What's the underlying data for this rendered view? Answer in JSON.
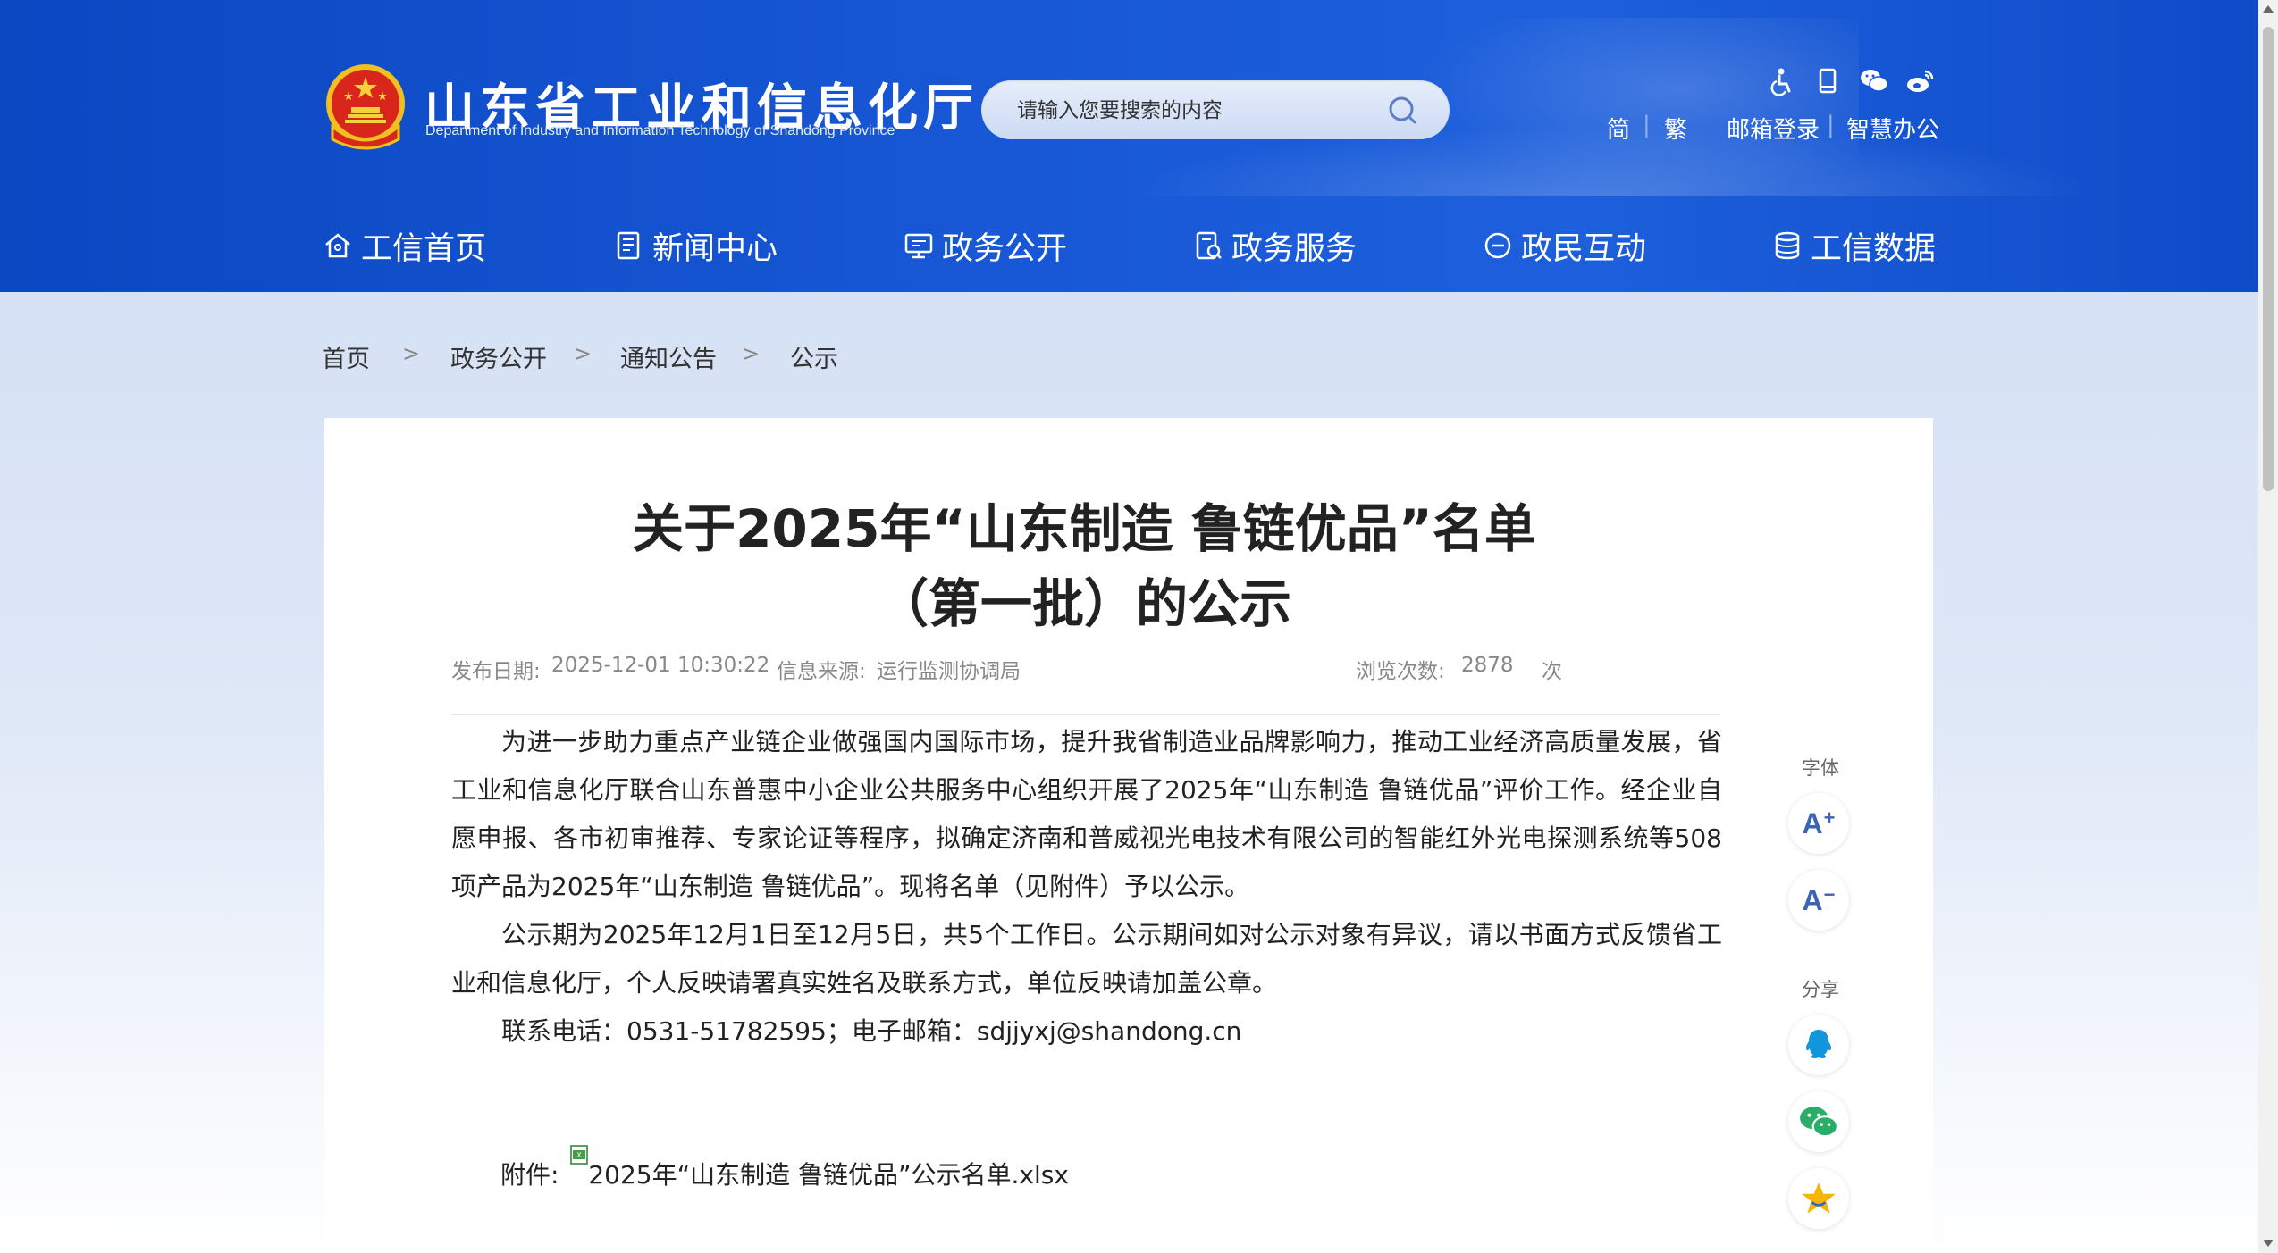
{
  "site": {
    "title": "山东省工业和信息化厅",
    "subtitle": "Department of Industry and Information Technology of Shandong Province"
  },
  "search": {
    "placeholder": "请输入您要搜索的内容"
  },
  "top_tools": {
    "icons": [
      "accessibility-icon",
      "mobile-icon",
      "wechat-icon",
      "weibo-icon"
    ],
    "links": [
      {
        "label": "简"
      },
      {
        "label": "繁"
      },
      {
        "label": "邮箱登录"
      },
      {
        "label": "智慧办公"
      }
    ]
  },
  "nav": [
    {
      "label": "工信首页",
      "icon": "home-icon"
    },
    {
      "label": "新闻中心",
      "icon": "news-icon"
    },
    {
      "label": "政务公开",
      "icon": "monitor-icon"
    },
    {
      "label": "政务服务",
      "icon": "service-icon"
    },
    {
      "label": "政民互动",
      "icon": "chat-icon"
    },
    {
      "label": "工信数据",
      "icon": "database-icon"
    }
  ],
  "breadcrumb": [
    "首页",
    "政务公开",
    "通知公告",
    "公示"
  ],
  "breadcrumb_sep": ">",
  "article": {
    "title_line1": "关于2025年“山东制造 鲁链优品”名单",
    "title_line2": "（第一批）的公示",
    "meta": {
      "date_label": "发布日期:",
      "date": "2025-12-01 10:30:22",
      "source_label": "信息来源:",
      "source": "运行监测协调局",
      "views_label": "浏览次数:",
      "views": "2878",
      "views_unit": "次"
    },
    "paragraphs": [
      "为进一步助力重点产业链企业做强国内国际市场，提升我省制造业品牌影响力，推动工业经济高质量发展，省工业和信息化厅联合山东普惠中小企业公共服务中心组织开展了2025年“山东制造 鲁链优品”评价工作。经企业自愿申报、各市初审推荐、专家论证等程序，拟确定济南和普威视光电技术有限公司的智能红外光电探测系统等508项产品为2025年“山东制造 鲁链优品”。现将名单（见附件）予以公示。",
      "公示期为2025年12月1日至12月5日，共5个工作日。公示期间如对公示对象有异议，请以书面方式反馈省工业和信息化厅，个人反映请署真实姓名及联系方式，单位反映请加盖公章。",
      "联系电话：0531-51782595；电子邮箱：sdjjyxj@shandong.cn"
    ],
    "attachment_label": "附件:",
    "attachment_name": "2025年“山东制造 鲁链优品”公示名单.xlsx"
  },
  "side": {
    "font_label": "字体",
    "font_increase": "A",
    "font_increase_sup": "+",
    "font_decrease": "A",
    "font_decrease_sup": "−",
    "share_label": "分享"
  },
  "colors": {
    "header_blue": "#1858d6",
    "nav_text": "#ffffff",
    "side_icon": "#3c64b2",
    "qq_blue": "#1296db",
    "wechat_green": "#2aae67",
    "star_gold": "#f5b500"
  }
}
